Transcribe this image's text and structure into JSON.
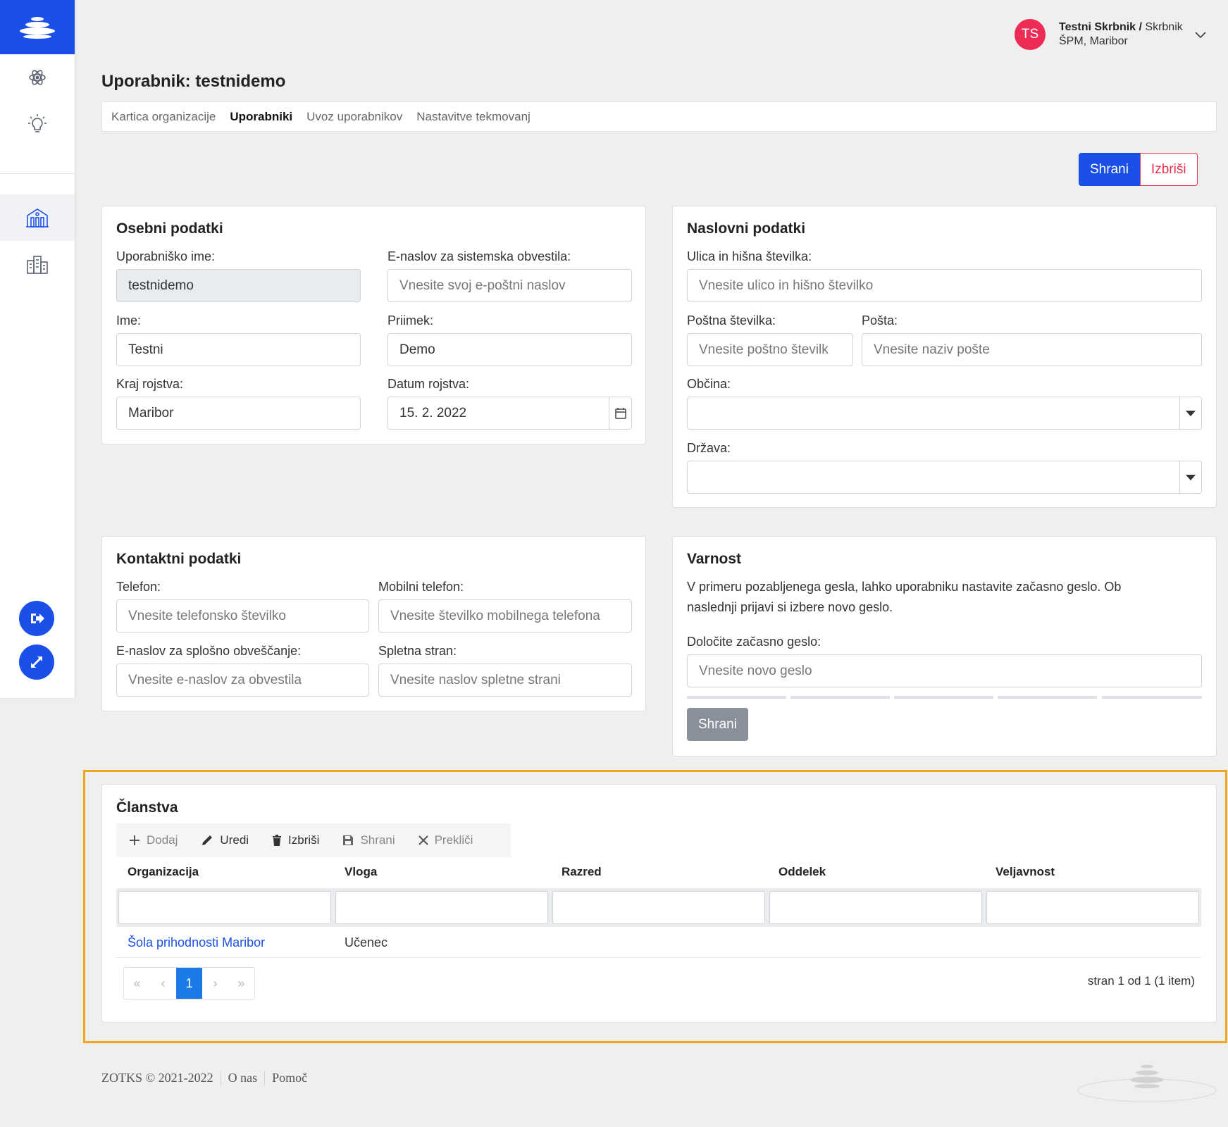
{
  "colors": {
    "accent": "#1a4fe8",
    "danger": "#e8344e",
    "avatar": "#ee2b54",
    "highlight": "#f0a81d"
  },
  "sidebar": {
    "icons": [
      "atom-icon",
      "lightbulb-icon",
      "organization-building-icon",
      "buildings-icon"
    ],
    "bottom_buttons": [
      "logout-icon",
      "expand-icon"
    ]
  },
  "header": {
    "avatar_initials": "TS",
    "user_name": "Testni Skrbnik /",
    "user_role": "Skrbnik",
    "user_org": "ŠPM, Maribor"
  },
  "page": {
    "title": "Uporabnik: testnidemo",
    "tabs": [
      "Kartica organizacije",
      "Uporabniki",
      "Uvoz uporabnikov",
      "Nastavitve tekmovanj"
    ],
    "active_tab": "Uporabniki",
    "save_label": "Shrani",
    "delete_label": "Izbriši"
  },
  "osebni": {
    "title": "Osebni podatki",
    "username_label": "Uporabniško ime:",
    "username_value": "testnidemo",
    "email_label": "E-naslov za sistemska obvestila:",
    "email_placeholder": "Vnesite svoj e-poštni naslov",
    "first_label": "Ime:",
    "first_value": "Testni",
    "last_label": "Priimek:",
    "last_value": "Demo",
    "birthplace_label": "Kraj rojstva:",
    "birthplace_value": "Maribor",
    "birthdate_label": "Datum rojstva:",
    "birthdate_value": "15. 2. 2022"
  },
  "naslovni": {
    "title": "Naslovni podatki",
    "street_label": "Ulica in hišna številka:",
    "street_placeholder": "Vnesite ulico in hišno številko",
    "postal_label": "Poštna številka:",
    "postal_placeholder": "Vnesite poštno številk",
    "post_label": "Pošta:",
    "post_placeholder": "Vnesite naziv pošte",
    "municipality_label": "Občina:",
    "country_label": "Država:"
  },
  "kontaktni": {
    "title": "Kontaktni podatki",
    "phone_label": "Telefon:",
    "phone_placeholder": "Vnesite telefonsko številko",
    "mobile_label": "Mobilni telefon:",
    "mobile_placeholder": "Vnesite številko mobilnega telefona",
    "general_email_label": "E-naslov za splošno obveščanje:",
    "general_email_placeholder": "Vnesite e-naslov za obvestila",
    "website_label": "Spletna stran:",
    "website_placeholder": "Vnesite naslov spletne strani"
  },
  "varnost": {
    "title": "Varnost",
    "text_line1": "V primeru pozabljenega gesla, lahko uporabniku nastavite začasno geslo. Ob",
    "text_line2": "naslednji prijavi si izbere novo geslo.",
    "password_label": "Določite začasno geslo:",
    "password_placeholder": "Vnesite novo geslo",
    "save_label": "Shrani"
  },
  "clanstva": {
    "title": "Članstva",
    "toolbar": {
      "add": "Dodaj",
      "edit": "Uredi",
      "delete": "Izbriši",
      "save": "Shrani",
      "cancel": "Prekliči"
    },
    "columns": [
      "Organizacija",
      "Vloga",
      "Razred",
      "Oddelek",
      "Veljavnost"
    ],
    "rows": [
      {
        "organization": "Šola prihodnosti Maribor",
        "role": "Učenec",
        "class": "",
        "department": "",
        "validity": ""
      }
    ],
    "pager": {
      "first": "«",
      "prev": "‹",
      "current": "1",
      "next": "›",
      "last": "»"
    },
    "page_info": "stran 1 od 1 (1 item)"
  },
  "footer": {
    "copyright": "ZOTKS © 2021-2022",
    "about": "O nas",
    "help": "Pomoč"
  }
}
